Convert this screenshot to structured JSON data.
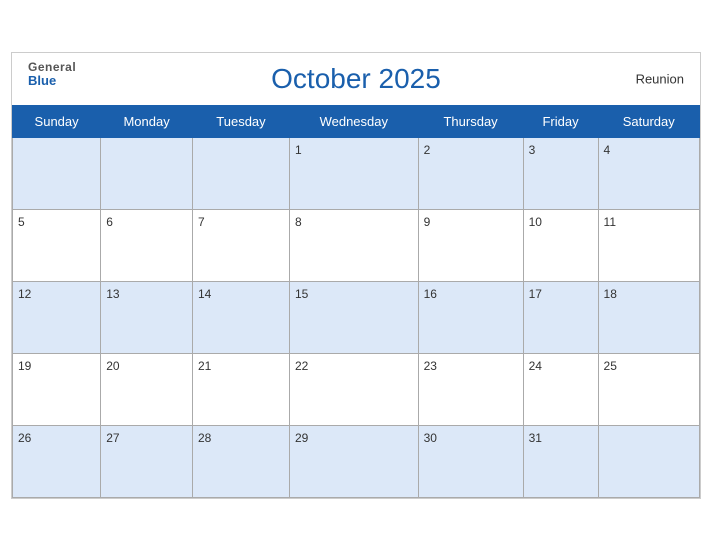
{
  "header": {
    "logo_general": "General",
    "logo_blue": "Blue",
    "title": "October 2025",
    "region": "Reunion"
  },
  "weekdays": [
    "Sunday",
    "Monday",
    "Tuesday",
    "Wednesday",
    "Thursday",
    "Friday",
    "Saturday"
  ],
  "weeks": [
    [
      null,
      null,
      null,
      1,
      2,
      3,
      4
    ],
    [
      5,
      6,
      7,
      8,
      9,
      10,
      11
    ],
    [
      12,
      13,
      14,
      15,
      16,
      17,
      18
    ],
    [
      19,
      20,
      21,
      22,
      23,
      24,
      25
    ],
    [
      26,
      27,
      28,
      29,
      30,
      31,
      null
    ]
  ],
  "row_styles": [
    "shaded",
    "white",
    "shaded",
    "white",
    "shaded"
  ]
}
